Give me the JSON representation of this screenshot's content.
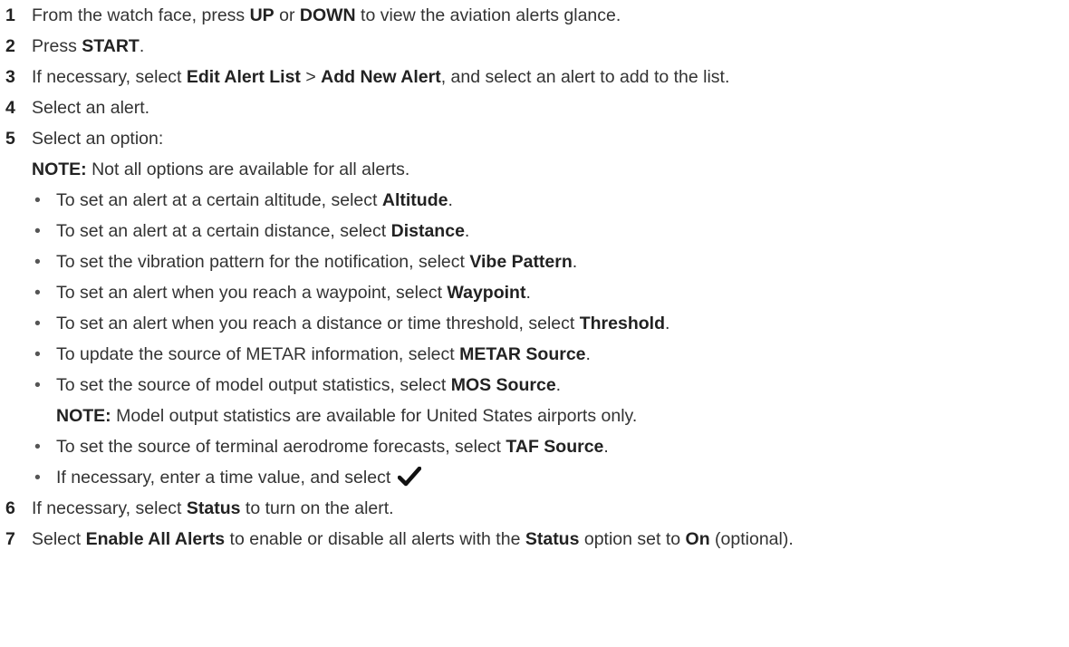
{
  "steps": [
    {
      "num": "1",
      "p1": "From the watch face, press ",
      "b1": "UP",
      "p2": " or ",
      "b2": "DOWN",
      "p3": " to view the aviation alerts glance."
    },
    {
      "num": "2",
      "p1": "Press ",
      "b1": "START",
      "p2": "."
    },
    {
      "num": "3",
      "p1": "If necessary, select ",
      "b1": "Edit Alert List",
      "p2": " > ",
      "b2": "Add New Alert",
      "p3": ", and select an alert to add to the list."
    },
    {
      "num": "4",
      "p1": "Select an alert."
    },
    {
      "num": "5",
      "p1": "Select an option:"
    },
    {
      "num": "6",
      "p1": "If necessary, select ",
      "b1": "Status",
      "p2": " to turn on the alert."
    },
    {
      "num": "7",
      "p1": "Select ",
      "b1": "Enable All Alerts",
      "p2": " to enable or disable all alerts with the ",
      "b2": "Status",
      "p3": " option set to ",
      "b3": "On",
      "p4": " (optional)."
    }
  ],
  "note1": {
    "label": "NOTE:",
    "text": " Not all options are available for all alerts."
  },
  "bullet_char": "•",
  "bullets": [
    {
      "p1": "To set an alert at a certain altitude, select ",
      "b1": "Altitude",
      "p2": "."
    },
    {
      "p1": "To set an alert at a certain distance, select ",
      "b1": "Distance",
      "p2": "."
    },
    {
      "p1": "To set the vibration pattern for the notification, select ",
      "b1": "Vibe Pattern",
      "p2": "."
    },
    {
      "p1": "To set an alert when you reach a waypoint, select ",
      "b1": "Waypoint",
      "p2": "."
    },
    {
      "p1": "To set an alert when you reach a distance or time threshold, select ",
      "b1": "Threshold",
      "p2": "."
    },
    {
      "p1": "To update the source of METAR information, select ",
      "b1": "METAR Source",
      "p2": "."
    },
    {
      "p1": "To set the source of model output statistics, select ",
      "b1": "MOS Source",
      "p2": "."
    },
    {
      "p1": "To set the source of terminal aerodrome forecasts, select ",
      "b1": "TAF Source",
      "p2": "."
    },
    {
      "p1": "If necessary, enter a time value, and select "
    }
  ],
  "note2": {
    "label": "NOTE:",
    "text": " Model output statistics are available for United States airports only."
  },
  "icons": {
    "check": "checkmark-icon"
  }
}
